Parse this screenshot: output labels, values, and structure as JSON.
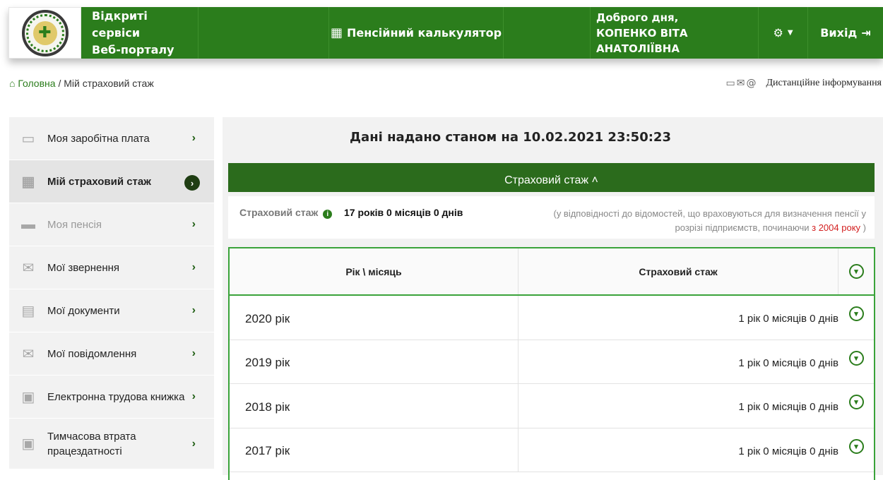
{
  "header": {
    "title_line1": "Відкриті сервіси",
    "title_line2": "Веб-порталу",
    "calculator_label": "Пенсійний калькулятор",
    "greeting": "Доброго дня,",
    "user_name": "КОПЕНКО ВІТА АНАТОЛІЇВНА",
    "exit_label": "Вихід",
    "icons": [
      "calculator-icon",
      "gear-icon",
      "sign-out-icon"
    ]
  },
  "breadcrumb": {
    "home": "Головна",
    "separator": "/",
    "current": "Мій страховий стаж"
  },
  "remote_info": {
    "label": "Дистанційне інформування"
  },
  "sidebar": {
    "items": [
      {
        "label": "Моя заробітна плата",
        "icon": "wallet-icon"
      },
      {
        "label": "Мій страховий стаж",
        "icon": "calendar-icon",
        "active": true
      },
      {
        "label": "Моя пенсія",
        "icon": "folder-icon",
        "muted": true
      },
      {
        "label": "Мої звернення",
        "icon": "envelope-icon"
      },
      {
        "label": "Мої документи",
        "icon": "document-icon"
      },
      {
        "label": "Мої повідомлення",
        "icon": "envelope-outline-icon"
      },
      {
        "label": "Електронна трудова книжка",
        "icon": "workbook-icon"
      },
      {
        "label": "Тимчасова втрата працездатності",
        "icon": "workbook-icon"
      }
    ]
  },
  "main": {
    "date_text": "Дані надано станом на 10.02.2021 23:50:23",
    "section_title": "Страховий стаж",
    "stag_label": "Страховий стаж",
    "stag_value": "17 років 0 місяців 0 днів",
    "note_part1": "(у відповідності до відомостей, що враховуються для визначення пенсії у розрізі підприємств, починаючи",
    "note_red": "з 2004 року",
    "note_end": ")",
    "table": {
      "col_year": "Рік \\ місяць",
      "col_stag": "Страховий стаж",
      "rows": [
        {
          "year": "2020 рік",
          "value": "1 рік 0 місяців 0 днів"
        },
        {
          "year": "2019 рік",
          "value": "1 рік 0 місяців 0 днів"
        },
        {
          "year": "2018 рік",
          "value": "1 рік 0 місяців 0 днів"
        },
        {
          "year": "2017 рік",
          "value": "1 рік 0 місяців 0 днів"
        }
      ]
    }
  },
  "colors": {
    "brand_green": "#2b7d1c",
    "dark_green_bar": "#2b6b1c",
    "accent_red": "#d32020"
  }
}
